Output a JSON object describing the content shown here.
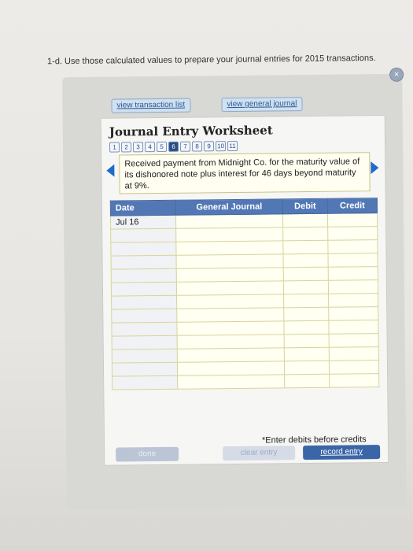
{
  "instruction": "1-d. Use those calculated values to prepare your journal entries for 2015 transactions.",
  "tabs": {
    "view_transaction_list": "view transaction list",
    "view_general_journal": "view general journal"
  },
  "worksheet": {
    "title": "Journal Entry Worksheet",
    "steps": [
      "1",
      "2",
      "3",
      "4",
      "5",
      "6",
      "7",
      "8",
      "9",
      "10",
      "11"
    ],
    "current_step": "6",
    "description": "Received payment from Midnight Co. for the maturity value of its dishonored note plus interest for 46 days beyond maturity at 9%."
  },
  "table": {
    "headers": [
      "Date",
      "General Journal",
      "Debit",
      "Credit"
    ],
    "rows": [
      [
        "Jul 16",
        "",
        "",
        ""
      ],
      [
        "",
        "",
        "",
        ""
      ],
      [
        "",
        "",
        "",
        ""
      ],
      [
        "",
        "",
        "",
        ""
      ],
      [
        "",
        "",
        "",
        ""
      ],
      [
        "",
        "",
        "",
        ""
      ],
      [
        "",
        "",
        "",
        ""
      ],
      [
        "",
        "",
        "",
        ""
      ],
      [
        "",
        "",
        "",
        ""
      ],
      [
        "",
        "",
        "",
        ""
      ],
      [
        "",
        "",
        "",
        ""
      ],
      [
        "",
        "",
        "",
        ""
      ],
      [
        "",
        "",
        "",
        ""
      ]
    ]
  },
  "note": "*Enter debits before credits",
  "buttons": {
    "done": "done",
    "clear_entry": "clear entry",
    "record_entry": "record entry"
  },
  "close_symbol": "×"
}
